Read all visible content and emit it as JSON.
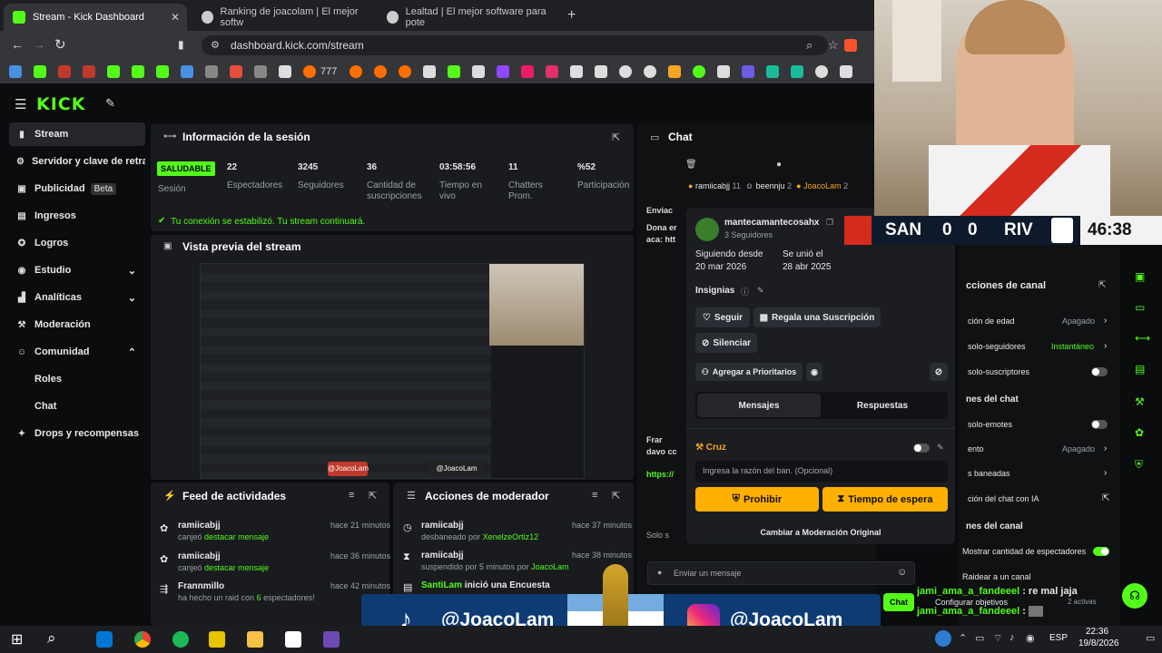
{
  "browser": {
    "tabs": [
      {
        "title": "Stream - Kick Dashboard"
      },
      {
        "title": "Ranking de joacolam | El mejor softw"
      },
      {
        "title": "Lealtad | El mejor software para pote"
      }
    ],
    "url": "dashboard.kick.com/stream",
    "bookmark_777": "777"
  },
  "sidebar": {
    "items": [
      {
        "label": "Stream"
      },
      {
        "label": "Servidor y clave de retran"
      },
      {
        "label": "Publicidad",
        "badge": "Beta"
      },
      {
        "label": "Ingresos"
      },
      {
        "label": "Logros"
      },
      {
        "label": "Estudio"
      },
      {
        "label": "Analíticas"
      },
      {
        "label": "Moderación"
      },
      {
        "label": "Comunidad"
      },
      {
        "label": "Roles"
      },
      {
        "label": "Chat"
      },
      {
        "label": "Drops y recompensas"
      }
    ]
  },
  "session": {
    "title": "Información de la sesión",
    "status": "SALUDABLE",
    "status_label": "Sesión",
    "stats": [
      {
        "value": "22",
        "label": "Espectadores"
      },
      {
        "value": "3245",
        "label": "Seguidores"
      },
      {
        "value": "36",
        "label": "Cantidad de suscripciones"
      },
      {
        "value": "03:58:56",
        "label": "Tiempo en vivo"
      },
      {
        "value": "11",
        "label": "Chatters Prom."
      },
      {
        "value": "%52",
        "label": "Participación"
      }
    ],
    "notice": "Tu conexión se estabilizó. Tu stream continuará."
  },
  "preview": {
    "title": "Vista previa del stream",
    "handle1": "@JoacoLam",
    "handle2": "@JoacoLam"
  },
  "feed": {
    "title": "Feed de actividades",
    "items": [
      {
        "user": "ramiicabjj",
        "text": "canjeó",
        "highlight": "destacar mensaje",
        "time": "hace 21 minutos"
      },
      {
        "user": "ramiicabjj",
        "text": "canjeó",
        "highlight": "destacar mensaje",
        "time": "hace 36 minutos"
      },
      {
        "user": "Frannmillo",
        "text": "ha hecho un raid con",
        "highlight": "6",
        "text2": "espectadores!",
        "time": "hace 42 minutos"
      }
    ]
  },
  "modactions": {
    "title": "Acciones de moderador",
    "items": [
      {
        "user": "ramiicabjj",
        "text": "desbaneado por",
        "highlight": "XenelzeOrtiz12",
        "time": "hace 37 minutos"
      },
      {
        "user": "ramiicabjj",
        "text": "suspendido por 5 minutos por",
        "highlight": "JoacoLam",
        "time": "hace 38 minutos"
      },
      {
        "user": "SantiLam",
        "text": "inició una Encuesta",
        "time": ""
      }
    ]
  },
  "chat": {
    "title": "Chat",
    "top_users": [
      {
        "name": "ramiicabjj",
        "count": "11"
      },
      {
        "name": "beennju",
        "count": "2"
      },
      {
        "name": "JoacoLam",
        "count": "2"
      }
    ],
    "left_texts": [
      "Enviac",
      "Dona er",
      "aca: htt",
      "Frar",
      "davo cc",
      "https://",
      "Solo s"
    ],
    "input_placeholder": "Enviar un mensaje",
    "send_label": "Chat"
  },
  "usercard": {
    "name": "mantecamantecosahx",
    "followers": "3 Seguidores",
    "following_since_label": "Siguiendo desde",
    "following_since": "20 mar 2026",
    "joined_label": "Se unió el",
    "joined": "28 abr 2025",
    "badges_label": "Insignias",
    "follow": "Seguir",
    "gift": "Regala una Suscripción",
    "mute": "Silenciar",
    "priority": "Agregar a Prioritarios",
    "tab_messages": "Mensajes",
    "tab_replies": "Respuestas",
    "ban_title": "Cruz",
    "ban_placeholder": "Ingresa la razón del ban. (Opcional)",
    "ban_button": "Prohibir",
    "timeout_button": "Tiempo de espera",
    "switch_mod": "Cambiar a Moderación Original"
  },
  "scoreboard": {
    "home": "SAN",
    "home_score": "0",
    "away_score": "0",
    "away": "RIV",
    "clock": "46:38"
  },
  "channel_actions": {
    "title": "cciones de canal",
    "rows": [
      {
        "label": "ción de edad",
        "value": "Apagado"
      },
      {
        "label": "solo-seguidores",
        "value": "Instantáneo"
      },
      {
        "label": "solo-suscriptores",
        "value": ""
      },
      {
        "label": "nes del chat",
        "value": ""
      },
      {
        "label": "solo-emotes",
        "value": ""
      },
      {
        "label": "ento",
        "value": "Apagado"
      },
      {
        "label": "s baneadas",
        "value": ""
      },
      {
        "label": "ción del chat con IA",
        "value": ""
      },
      {
        "label": "nes del canal",
        "value": ""
      },
      {
        "label": "Mostrar cantidad de espectadores",
        "value": ""
      },
      {
        "label": "Raidear a un canal",
        "value": ""
      },
      {
        "label": "Configurar objetivos",
        "value": "2 activas"
      }
    ]
  },
  "overlay_chat": [
    {
      "user": "jami_ama_a_fandeeel",
      "msg": "re mal jaja"
    },
    {
      "user": "jami_ama_a_fandeeel",
      "msg": ""
    }
  ],
  "socials": [
    {
      "handle": "@JoacoLam"
    },
    {
      "handle": "@JoacoLam"
    }
  ],
  "taskbar": {
    "lang": "ESP",
    "time": "22:36",
    "date": "19/8/2026"
  },
  "colors": {
    "kick_green": "#53fc18",
    "prohibit": "#f5a623",
    "accent": "#ffb000"
  }
}
